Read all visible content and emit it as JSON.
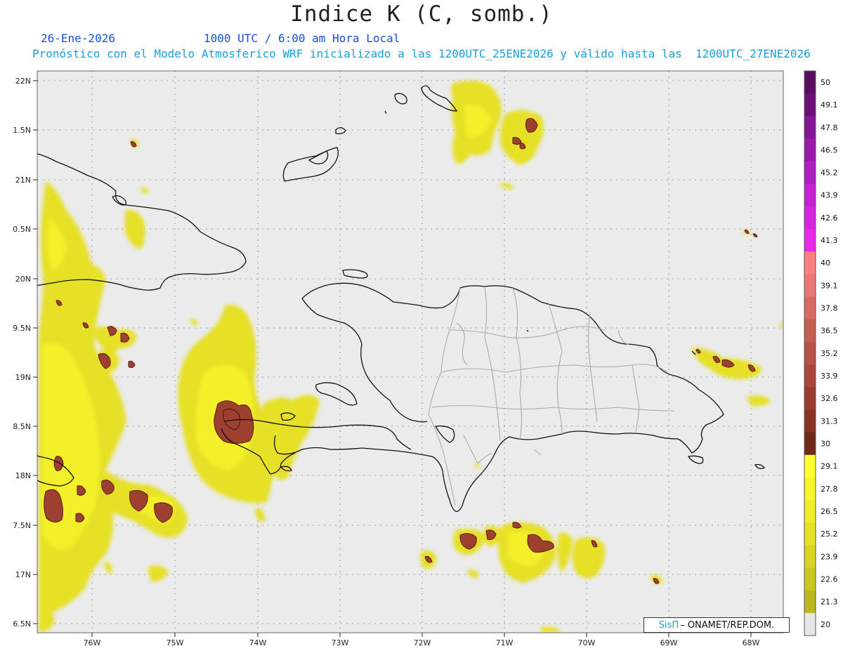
{
  "header": {
    "title": "Indice K (C, somb.)",
    "date": "26-Ene-2026",
    "time": "1000 UTC / 6:00 am Hora Local",
    "info": "Pronóstico con el Modelo Atmosferico WRF inicializado a las 1200UTC_25ENE2026 y válido hasta las  1200UTC_27ENE2026"
  },
  "axes": {
    "lat_labels": [
      "22N",
      "1.5N",
      "21N",
      "0.5N",
      "20N",
      "9.5N",
      "19N",
      "8.5N",
      "18N",
      "7.5N",
      "17N",
      "6.5N"
    ],
    "lon_labels": [
      "76W",
      "75W",
      "74W",
      "73W",
      "72W",
      "71W",
      "70W",
      "69W",
      "68W"
    ]
  },
  "colorbar": {
    "levels": [
      "50",
      "49.1",
      "47.8",
      "46.5",
      "45.2",
      "43.9",
      "42.6",
      "41.3",
      "40",
      "39.1",
      "37.8",
      "36.5",
      "35.2",
      "33.9",
      "32.6",
      "31.3",
      "30",
      "29.1",
      "27.8",
      "26.5",
      "25.2",
      "23.9",
      "22.6",
      "21.3",
      "20"
    ],
    "colors": [
      "#5a0c5e",
      "#6e0f78",
      "#861496",
      "#9a19aa",
      "#b01fc2",
      "#c522d4",
      "#d826e0",
      "#ea29ea",
      "#ff8080",
      "#ea7676",
      "#d86a62",
      "#c75e52",
      "#b85246",
      "#a9473a",
      "#993c2f",
      "#8a3224",
      "#6e2a16",
      "#ffff30",
      "#f8f52c",
      "#f0ec28",
      "#e6e026",
      "#d9d324",
      "#ccc620",
      "#bcb71e",
      "#e6e6e6"
    ]
  },
  "credit": {
    "logo": "SisΠ",
    "org": "– ONAMET/REP.DOM."
  }
}
